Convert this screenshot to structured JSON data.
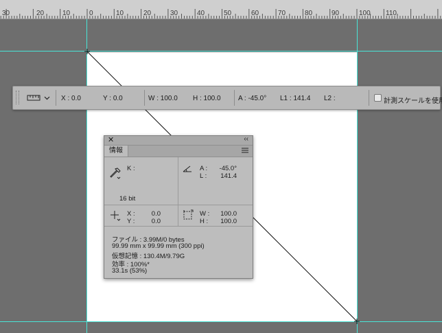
{
  "ruler": {
    "labels": [
      "30",
      "20",
      "10",
      "0",
      "10",
      "20",
      "30",
      "40",
      "50",
      "60",
      "70",
      "80",
      "90",
      "100",
      "110"
    ]
  },
  "options_bar": {
    "tool_icon": "ruler-icon",
    "x": "X : 0.0",
    "y": "Y : 0.0",
    "w": "W : 100.0",
    "h": "H : 100.0",
    "a": "A : -45.0°",
    "l1": "L1 : 141.4",
    "l2": "L2 :",
    "use_measurement_scale": "計測スケールを使用"
  },
  "info_panel": {
    "close_glyph": "✕",
    "collapse_glyph": "‹‹",
    "tab_label": "情報",
    "k_label": "K :",
    "bit_depth": "16 bit",
    "a_label": "A :",
    "a_value": "-45.0°",
    "l_label": "L :",
    "l_value": "141.4",
    "x_label": "X :",
    "x_value": "0.0",
    "y_label": "Y :",
    "y_value": "0.0",
    "w_label": "W :",
    "w_value": "100.0",
    "h_label": "H :",
    "h_value": "100.0",
    "status_lines": [
      "ファイル : 3.99M/0 bytes",
      "99.99 mm x 99.99 mm (300 ppi)",
      "仮想記憶 : 130.4M/9.79G",
      "効率 : 100%*",
      "33.1s (53%)"
    ]
  },
  "colors": {
    "guide": "#48e6d8",
    "canvas_bg": "#6e6e6e",
    "panel_bg": "#bdbdbd"
  }
}
